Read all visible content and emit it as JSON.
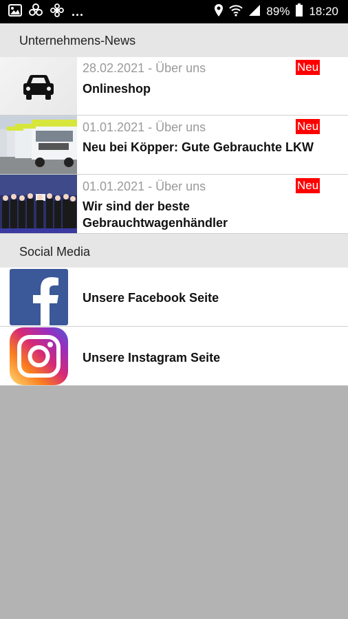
{
  "status_bar": {
    "dots": "...",
    "battery_percent": "89%",
    "time": "18:20",
    "icons": [
      "image-icon",
      "pinwheel-icon",
      "flower-icon",
      "location-icon",
      "wifi-icon",
      "signal-icon",
      "battery-icon"
    ]
  },
  "sections": {
    "news_header": "Unternehmens-News",
    "social_header": "Social Media"
  },
  "news_items": [
    {
      "meta": "28.02.2021 - Über uns",
      "title": "Onlineshop",
      "badge": "Neu",
      "thumb": "car-icon"
    },
    {
      "meta": "01.01.2021 - Über uns",
      "title": "Neu bei Köpper: Gute Gebrauchte LKW",
      "badge": "Neu",
      "thumb": "trucks-photo"
    },
    {
      "meta": "01.01.2021 - Über uns",
      "title": "Wir sind der beste Gebrauchtwagenhändler",
      "badge": "Neu",
      "thumb": "team-photo"
    }
  ],
  "social_items": [
    {
      "label": "Unsere Facebook Seite",
      "icon": "facebook-icon"
    },
    {
      "label": "Unsere Instagram Seite",
      "icon": "instagram-icon"
    }
  ],
  "colors": {
    "badge_red": "#ff0000",
    "facebook_blue": "#3b5998",
    "section_header_bg": "#e6e6e6",
    "empty_area_bg": "#b3b3b3"
  }
}
